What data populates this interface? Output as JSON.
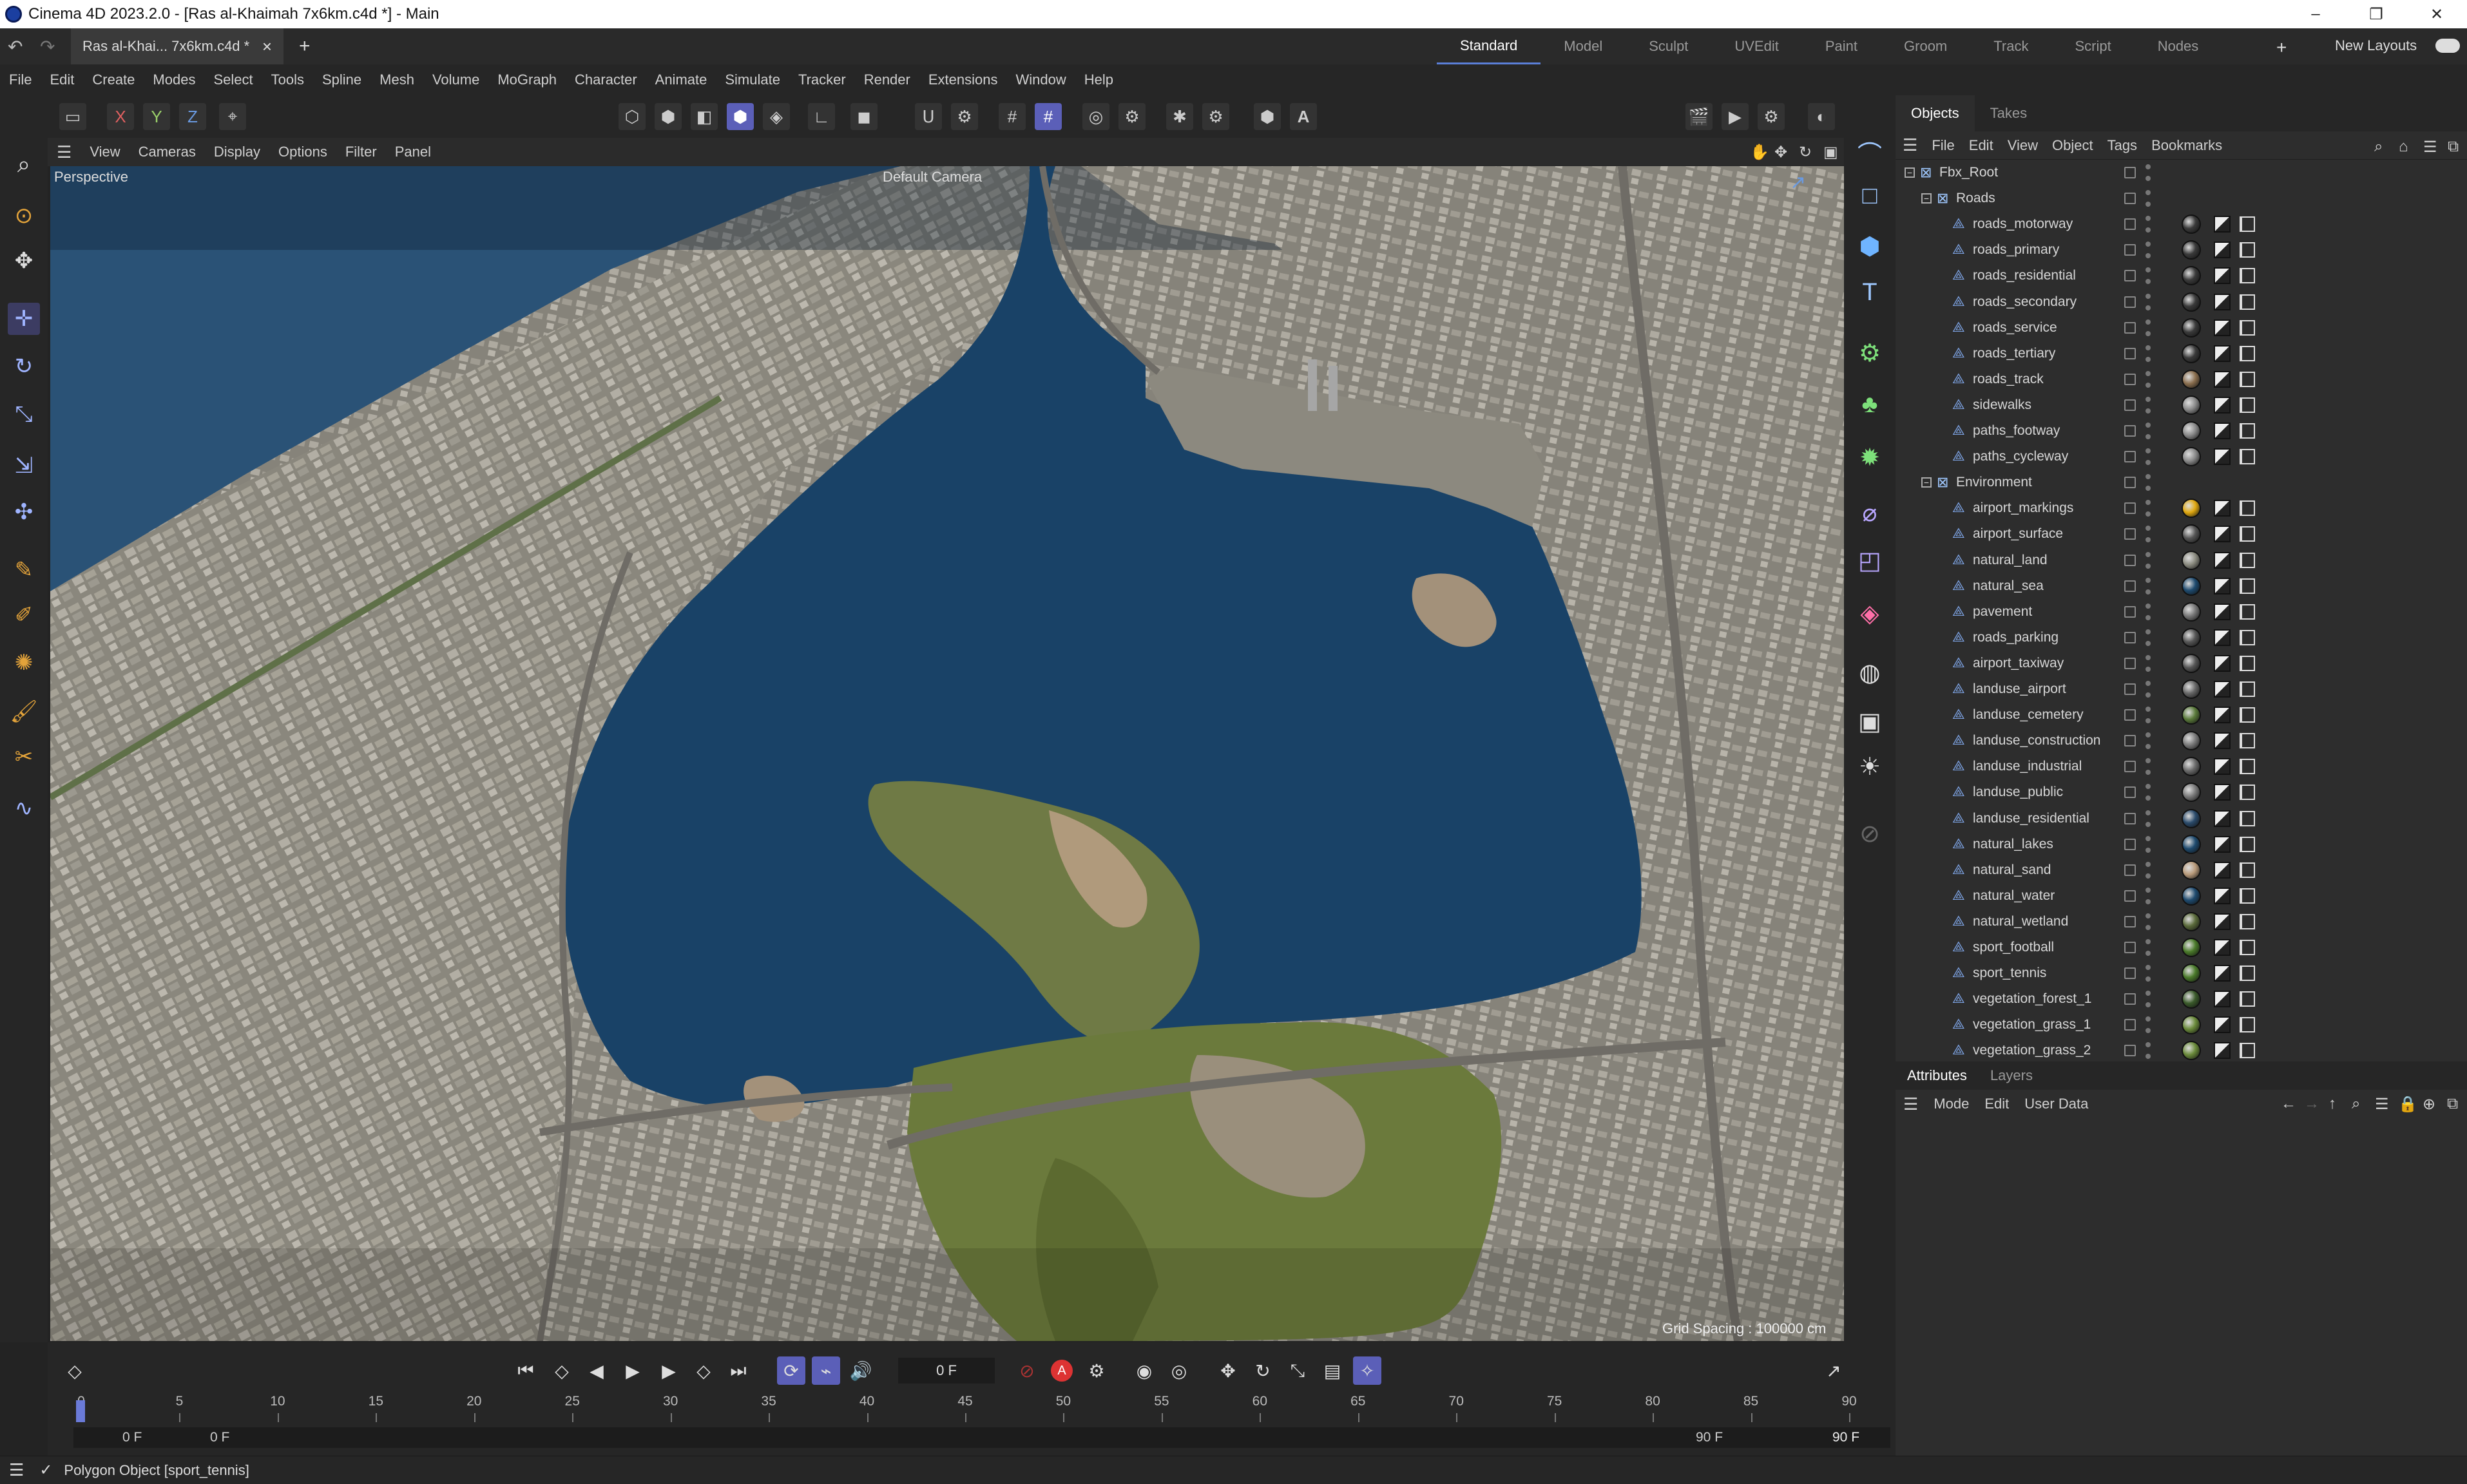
{
  "window": {
    "title": "Cinema 4D 2023.2.0 - [Ras al-Khaimah 7x6km.c4d *] - Main",
    "min": "–",
    "max": "❐",
    "close": "✕"
  },
  "tabs": {
    "doc_tab": "Ras al-Khai... 7x6km.c4d *",
    "close": "×",
    "add": "+",
    "workspaces": [
      "Standard",
      "Model",
      "Sculpt",
      "UVEdit",
      "Paint",
      "Groom",
      "Track",
      "Script",
      "Nodes"
    ],
    "active_workspace": "Standard",
    "new_layouts": "New Layouts"
  },
  "menu": [
    "File",
    "Edit",
    "Create",
    "Modes",
    "Select",
    "Tools",
    "Spline",
    "Mesh",
    "Volume",
    "MoGraph",
    "Character",
    "Animate",
    "Simulate",
    "Tracker",
    "Render",
    "Extensions",
    "Window",
    "Help"
  ],
  "toolbar": {
    "axis_x": "X",
    "axis_y": "Y",
    "axis_z": "Z"
  },
  "viewport": {
    "menu": [
      "View",
      "Cameras",
      "Display",
      "Options",
      "Filter",
      "Panel"
    ],
    "label": "Perspective",
    "camera": "Default Camera",
    "grid_spacing": "Grid Spacing : 100000 cm"
  },
  "objects": {
    "tabs": [
      "Objects",
      "Takes"
    ],
    "menu": [
      "File",
      "Edit",
      "View",
      "Object",
      "Tags",
      "Bookmarks"
    ],
    "rows": [
      {
        "name": "Fbx_Root",
        "level": 0,
        "group": true,
        "mat": ""
      },
      {
        "name": "Roads",
        "level": 1,
        "group": true,
        "mat": ""
      },
      {
        "name": "roads_motorway",
        "level": 2,
        "mat": "#3a3a3a"
      },
      {
        "name": "roads_primary",
        "level": 2,
        "mat": "#3a3a3a"
      },
      {
        "name": "roads_residential",
        "level": 2,
        "mat": "#3a3a3a"
      },
      {
        "name": "roads_secondary",
        "level": 2,
        "mat": "#3a3a3a"
      },
      {
        "name": "roads_service",
        "level": 2,
        "mat": "#3a3a3a"
      },
      {
        "name": "roads_tertiary",
        "level": 2,
        "mat": "#3a3a3a"
      },
      {
        "name": "roads_track",
        "level": 2,
        "mat": "#8a6e4e"
      },
      {
        "name": "sidewalks",
        "level": 2,
        "mat": "#8a8a8a"
      },
      {
        "name": "paths_footway",
        "level": 2,
        "mat": "#8a8a8a"
      },
      {
        "name": "paths_cycleway",
        "level": 2,
        "mat": "#8a8a8a"
      },
      {
        "name": "Environment",
        "level": 1,
        "group": true,
        "mat": ""
      },
      {
        "name": "airport_markings",
        "level": 2,
        "mat": "#e0a810"
      },
      {
        "name": "airport_surface",
        "level": 2,
        "mat": "#555"
      },
      {
        "name": "natural_land",
        "level": 2,
        "mat": "#8b8b80"
      },
      {
        "name": "natural_sea",
        "level": 2,
        "mat": "#1e4a6e"
      },
      {
        "name": "pavement",
        "level": 2,
        "mat": "#777"
      },
      {
        "name": "roads_parking",
        "level": 2,
        "mat": "#555"
      },
      {
        "name": "airport_taxiway",
        "level": 2,
        "mat": "#555"
      },
      {
        "name": "landuse_airport",
        "level": 2,
        "mat": "#666"
      },
      {
        "name": "landuse_cemetery",
        "level": 2,
        "mat": "#5a7a3a"
      },
      {
        "name": "landuse_construction",
        "level": 2,
        "mat": "#7a7a7a"
      },
      {
        "name": "landuse_industrial",
        "level": 2,
        "mat": "#6a6a6a"
      },
      {
        "name": "landuse_public",
        "level": 2,
        "mat": "#7a7a7a"
      },
      {
        "name": "landuse_residential",
        "level": 2,
        "mat": "#2a4a6a"
      },
      {
        "name": "natural_lakes",
        "level": 2,
        "mat": "#1e4a6e"
      },
      {
        "name": "natural_sand",
        "level": 2,
        "mat": "#b89a7a"
      },
      {
        "name": "natural_water",
        "level": 2,
        "mat": "#1e4a6e"
      },
      {
        "name": "natural_wetland",
        "level": 2,
        "mat": "#5a6a3a"
      },
      {
        "name": "sport_football",
        "level": 2,
        "mat": "#4a7a2a"
      },
      {
        "name": "sport_tennis",
        "level": 2,
        "mat": "#4a7a2a"
      },
      {
        "name": "vegetation_forest_1",
        "level": 2,
        "mat": "#3a5a2a"
      },
      {
        "name": "vegetation_grass_1",
        "level": 2,
        "mat": "#6a8a3a"
      },
      {
        "name": "vegetation_grass_2",
        "level": 2,
        "mat": "#6a8a3a"
      }
    ]
  },
  "attributes": {
    "tabs": [
      "Attributes",
      "Layers"
    ],
    "menu": [
      "Mode",
      "Edit",
      "User Data"
    ]
  },
  "timeline": {
    "current_frame": "0 F",
    "ticks": [
      "0",
      "5",
      "10",
      "15",
      "20",
      "25",
      "30",
      "35",
      "40",
      "45",
      "50",
      "55",
      "60",
      "65",
      "70",
      "75",
      "80",
      "85",
      "90"
    ],
    "range_start": "0 F",
    "range_start2": "0 F",
    "range_end": "90 F",
    "range_end2": "90 F"
  },
  "status": {
    "text": "Polygon Object [sport_tennis]"
  }
}
